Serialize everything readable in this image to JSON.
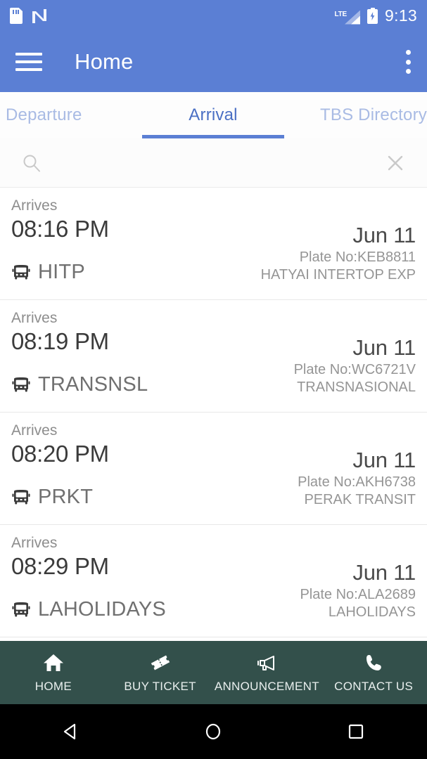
{
  "status_bar": {
    "time": "9:13",
    "network_type": "LTE",
    "icons": [
      "sd-card-icon",
      "android-n-icon",
      "signal-icon",
      "battery-charging-icon"
    ]
  },
  "toolbar": {
    "title": "Home",
    "menu_icon": "hamburger-icon",
    "overflow_icon": "kebab-menu-icon",
    "background_color": "#5b7fd4"
  },
  "tabs": {
    "items": [
      {
        "label": "Departure",
        "active": false
      },
      {
        "label": "Arrival",
        "active": true
      },
      {
        "label": "TBS Directory",
        "active": false
      }
    ],
    "active_color": "#4a6fc4",
    "inactive_color": "#a9bbe4",
    "indicator_color": "#5b7fd4"
  },
  "search": {
    "value": "",
    "placeholder": "",
    "search_icon": "search-icon",
    "clear_icon": "close-icon"
  },
  "list": {
    "rows": [
      {
        "status_label": "Arrives",
        "time": "08:16 PM",
        "date": "Jun 11",
        "operator_code": "HITP",
        "plate": "Plate No:KEB8811",
        "operator_name": "HATYAI INTERTOP EXP"
      },
      {
        "status_label": "Arrives",
        "time": "08:19 PM",
        "date": "Jun 11",
        "operator_code": "TRANSNSL",
        "plate": "Plate No:WC6721V",
        "operator_name": "TRANSNASIONAL"
      },
      {
        "status_label": "Arrives",
        "time": "08:20 PM",
        "date": "Jun 11",
        "operator_code": "PRKT",
        "plate": "Plate No:AKH6738",
        "operator_name": "PERAK TRANSIT"
      },
      {
        "status_label": "Arrives",
        "time": "08:29 PM",
        "date": "Jun 11",
        "operator_code": "LAHOLIDAYS",
        "plate": "Plate No:ALA2689",
        "operator_name": "LAHOLIDAYS"
      }
    ]
  },
  "bottom_nav": {
    "background_color": "#33504b",
    "items": [
      {
        "label": "HOME",
        "icon": "home-icon"
      },
      {
        "label": "BUY TICKET",
        "icon": "ticket-icon"
      },
      {
        "label": "ANNOUNCEMENT",
        "icon": "megaphone-icon"
      },
      {
        "label": "CONTACT US",
        "icon": "phone-icon"
      }
    ]
  },
  "system_nav": {
    "items": [
      {
        "name": "back",
        "icon": "triangle-back-icon"
      },
      {
        "name": "home",
        "icon": "circle-home-icon"
      },
      {
        "name": "recents",
        "icon": "square-recents-icon"
      }
    ]
  }
}
